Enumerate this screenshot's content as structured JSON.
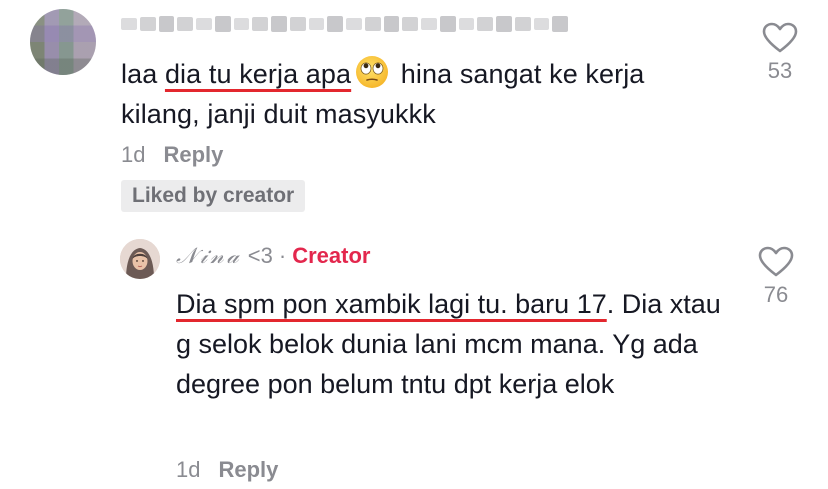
{
  "comments": [
    {
      "username_hidden": true,
      "text_segments": {
        "pre": "laa ",
        "underlined": "dia tu kerja apa",
        "emoji": "eye-roll-emoji",
        "post": " hina sangat ke kerja kilang, janji duit masyukkk"
      },
      "time": "1d",
      "reply_label": "Reply",
      "liked_badge": "Liked by creator",
      "likes": "53"
    }
  ],
  "reply": {
    "name": "𝒩𝒾𝓃𝒶",
    "name_suffix": "<3",
    "separator": "·",
    "creator_label": "Creator",
    "text_segments": {
      "underlined": "Dia spm pon xambik lagi tu. baru 17",
      "post": ". Dia xtau g selok belok dunia lani mcm mana. Yg ada degree pon belum tntu dpt kerja elok"
    },
    "time": "1d",
    "reply_label": "Reply",
    "likes": "76"
  },
  "colors": {
    "text": "#161823",
    "muted": "#8a8b91",
    "creator": "#e3274d",
    "underline": "#e3272e",
    "badge_bg": "#ececed"
  }
}
